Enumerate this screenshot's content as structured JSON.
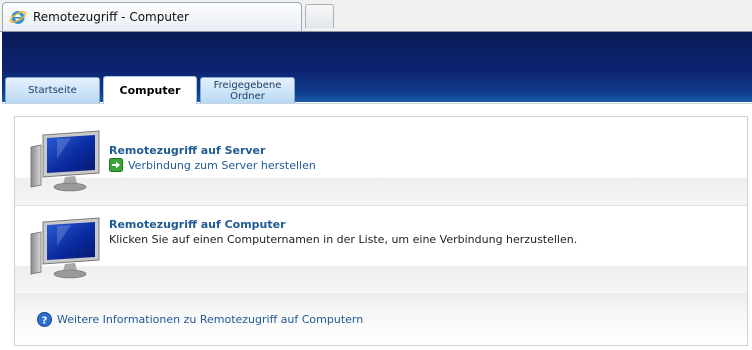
{
  "browser": {
    "tab_title": "Remotezugriff - Computer"
  },
  "tabs": [
    {
      "label": "Startseite"
    },
    {
      "label": "Computer"
    },
    {
      "label": "Freigegebene Ordner"
    }
  ],
  "server_section": {
    "title": "Remotezugriff auf Server",
    "link": "Verbindung zum Server herstellen"
  },
  "computer_section": {
    "title": "Remotezugriff auf Computer",
    "description": "Klicken Sie auf einen Computernamen in der Liste, um eine Verbindung herzustellen."
  },
  "footer": {
    "help_link": "Weitere Informationen zu Remotezugriff auf Computern"
  },
  "icons": {
    "browser": "ie-icon",
    "computer": "monitor-icon",
    "connect": "green-arrow-icon",
    "help": "help-icon"
  },
  "colors": {
    "banner": "#0d2370",
    "link": "#1f5a94",
    "tab": "#b9d9f5"
  }
}
